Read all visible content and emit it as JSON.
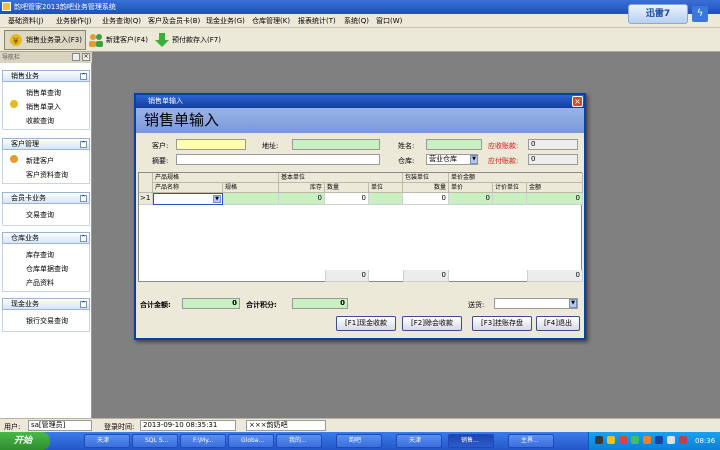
{
  "window": {
    "title": "韵吧管家2013韵吧业务管理系统"
  },
  "menu": [
    "基础资料(J)",
    "业务操作(J)",
    "业务查询(Q)",
    "客户及会员卡(B)",
    "现金业务(G)",
    "仓库管理(K)",
    "报表统计(T)",
    "系统(Q)",
    "窗口(W)"
  ],
  "brand": {
    "label": "迅雷7",
    "accent": "#3a78d8"
  },
  "toolbar": {
    "sales_entry": "销售业务录入(F3)",
    "new_customer": "新建客户(F4)",
    "prepaid": "预付款存入(F7)"
  },
  "sidebar": {
    "header": "导航栏",
    "groups": [
      {
        "title": "销售业务",
        "items": [
          "销售单查询",
          "销售单录入",
          "收款查询"
        ]
      },
      {
        "title": "客户管理",
        "items": [
          "新建客户",
          "客户资料查询"
        ]
      },
      {
        "title": "会员卡业务",
        "items": [
          "交易查询"
        ]
      },
      {
        "title": "仓库业务",
        "items": [
          "库存查询",
          "仓库单据查询",
          "产品资料"
        ]
      },
      {
        "title": "现金业务",
        "items": [
          "银行交易查询"
        ]
      }
    ]
  },
  "dialog": {
    "title": "销售单输入",
    "header": "销售单输入",
    "form": {
      "customer_label": "客户:",
      "address_label": "地址:",
      "name_label": "姓名:",
      "receivable_label": "应收账款:",
      "receivable_value": "0",
      "memo_label": "摘要:",
      "warehouse_label": "仓库:",
      "warehouse_value": "营业仓库",
      "payable_label": "应付账款:",
      "payable_value": "0"
    },
    "grid": {
      "group_headers": {
        "product_spec": "产品规格",
        "base_unit": "基本单位",
        "pack_unit": "包装单位",
        "price_amount": "单价金额"
      },
      "columns": [
        "产品名称",
        "规格",
        "库存",
        "数量",
        "单位",
        "数量",
        "单价",
        "计价单位",
        "金额"
      ],
      "row": {
        "marker": ">",
        "index": "1",
        "stock": "0",
        "qty": "0",
        "pack_qty": "0",
        "price": "0",
        "amount": "0"
      },
      "totals": {
        "base_qty": "0",
        "pack_qty": "0",
        "amount": "0"
      }
    },
    "footer": {
      "total_amount_label": "合计金额:",
      "total_amount": "0",
      "total_points_label": "合计积分:",
      "total_points": "0",
      "delivery_label": "送货:"
    },
    "buttons": {
      "cash": "[F1]现金收款",
      "credit": "[F2]赊会收款",
      "deposit": "[F3]挂账存盘",
      "exit": "[F4]退出"
    }
  },
  "statusbar": {
    "user_label": "用户:",
    "user_value": "sa[管理员]",
    "login_label": "登录时间:",
    "login_value": "2013-09-10 08:35:31",
    "shop": "×××韵奶吧"
  },
  "taskbar": {
    "start": "开始",
    "tasks": [
      "天津",
      "SQL S...",
      "F:\\My...",
      "Globa...",
      "我的...",
      "韵吧",
      "天津",
      "销售...",
      "主界..."
    ],
    "clock": "08:36"
  }
}
